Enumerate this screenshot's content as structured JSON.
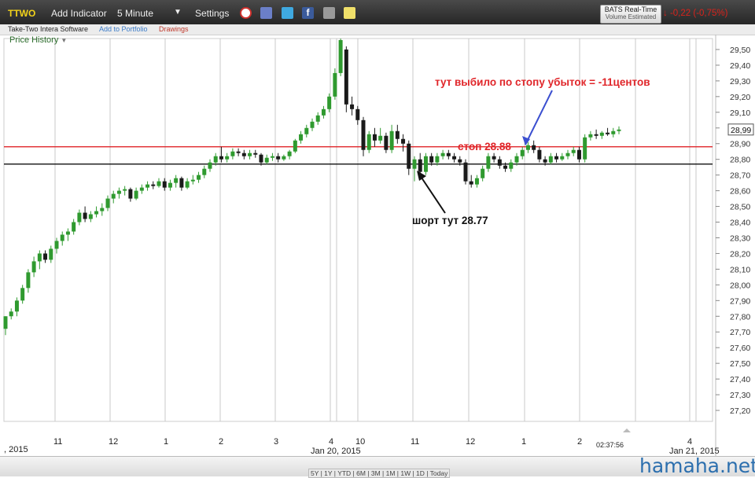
{
  "toolbar": {
    "ticker": "TTWO",
    "add_indicator": "Add Indicator",
    "interval": "5 Minute",
    "settings": "Settings",
    "realtime_title": "BATS Real-Time",
    "realtime_sub": "Volume Estimated",
    "change": "-0,22 (-0,75%)",
    "icons": [
      "alarm-clock-icon",
      "book-icon",
      "twitter-icon",
      "facebook-icon",
      "print-icon",
      "note-icon"
    ]
  },
  "subbar": {
    "company": "Take-Two Intera Software",
    "add_to_portfolio": "Add to Portfolio",
    "drawings": "Drawings"
  },
  "chart_label": "Price History",
  "periods": "5Y | 1Y | YTD | 6M | 3M | 1M | 1W | 1D | Today",
  "watermark": "hamaha.net",
  "chart_data": {
    "type": "candlestick",
    "ylim": [
      27.13,
      29.57
    ],
    "y_ticks": [
      "29,50",
      "29,40",
      "29,30",
      "29,20",
      "29,10",
      "29,00",
      "28,90",
      "28,80",
      "28,70",
      "28,60",
      "28,50",
      "28,40",
      "28,30",
      "28,20",
      "28,10",
      "28,00",
      "27,90",
      "27,80",
      "27,70",
      "27,60",
      "27,50",
      "27,40",
      "27,30",
      "27,20"
    ],
    "last_price": "28,99",
    "x_labels": [
      ", 2015",
      "11",
      "12",
      "1",
      "2",
      "3",
      "4",
      "10",
      "11",
      "12",
      "1",
      "2",
      "4",
      "Jan 20, 2015",
      "Jan 21, 2015",
      "02:37:56"
    ],
    "lines": [
      {
        "name": "stop",
        "value": 28.88,
        "color": "#e0262a"
      },
      {
        "name": "entry",
        "value": 28.77,
        "color": "#111111"
      }
    ],
    "annotations": [
      {
        "text": "тут выбило по стопу убыток = -11центов",
        "color": "#e0262a"
      },
      {
        "text": "стоп 28.88",
        "color": "#e0262a"
      },
      {
        "text": "шорт тут 28.77",
        "color": "#111111"
      }
    ],
    "candles": [
      [
        27.72,
        27.8,
        27.68,
        27.8
      ],
      [
        27.8,
        27.85,
        27.78,
        27.83
      ],
      [
        27.83,
        27.92,
        27.8,
        27.9
      ],
      [
        27.9,
        28.0,
        27.88,
        27.98
      ],
      [
        27.98,
        28.1,
        27.95,
        28.08
      ],
      [
        28.08,
        28.18,
        28.05,
        28.15
      ],
      [
        28.15,
        28.22,
        28.1,
        28.2
      ],
      [
        28.2,
        28.22,
        28.14,
        28.16
      ],
      [
        28.16,
        28.25,
        28.14,
        28.23
      ],
      [
        28.23,
        28.3,
        28.2,
        28.28
      ],
      [
        28.28,
        28.34,
        28.25,
        28.32
      ],
      [
        28.32,
        28.36,
        28.28,
        28.34
      ],
      [
        28.34,
        28.42,
        28.32,
        28.4
      ],
      [
        28.4,
        28.48,
        28.38,
        28.46
      ],
      [
        28.46,
        28.5,
        28.4,
        28.42
      ],
      [
        28.42,
        28.47,
        28.4,
        28.45
      ],
      [
        28.45,
        28.5,
        28.43,
        28.47
      ],
      [
        28.47,
        28.52,
        28.44,
        28.49
      ],
      [
        28.49,
        28.57,
        28.47,
        28.55
      ],
      [
        28.55,
        28.6,
        28.52,
        28.58
      ],
      [
        28.58,
        28.62,
        28.55,
        28.6
      ],
      [
        28.6,
        28.63,
        28.57,
        28.61
      ],
      [
        28.61,
        28.62,
        28.53,
        28.55
      ],
      [
        28.55,
        28.62,
        28.54,
        28.6
      ],
      [
        28.6,
        28.64,
        28.58,
        28.62
      ],
      [
        28.62,
        28.66,
        28.6,
        28.64
      ],
      [
        28.64,
        28.66,
        28.61,
        28.63
      ],
      [
        28.63,
        28.68,
        28.62,
        28.66
      ],
      [
        28.66,
        28.68,
        28.6,
        28.62
      ],
      [
        28.62,
        28.67,
        28.6,
        28.65
      ],
      [
        28.65,
        28.7,
        28.62,
        28.68
      ],
      [
        28.68,
        28.69,
        28.6,
        28.62
      ],
      [
        28.62,
        28.68,
        28.61,
        28.66
      ],
      [
        28.66,
        28.7,
        28.64,
        28.67
      ],
      [
        28.67,
        28.72,
        28.65,
        28.7
      ],
      [
        28.7,
        28.76,
        28.68,
        28.74
      ],
      [
        28.74,
        28.8,
        28.72,
        28.78
      ],
      [
        28.78,
        28.84,
        28.76,
        28.82
      ],
      [
        28.82,
        28.88,
        28.78,
        28.8
      ],
      [
        28.8,
        28.84,
        28.78,
        28.82
      ],
      [
        28.82,
        28.87,
        28.8,
        28.85
      ],
      [
        28.85,
        28.87,
        28.82,
        28.84
      ],
      [
        28.84,
        28.86,
        28.8,
        28.82
      ],
      [
        28.82,
        28.86,
        28.8,
        28.84
      ],
      [
        28.84,
        28.86,
        28.81,
        28.83
      ],
      [
        28.83,
        28.84,
        28.76,
        28.78
      ],
      [
        28.78,
        28.83,
        28.77,
        28.81
      ],
      [
        28.81,
        28.84,
        28.79,
        28.82
      ],
      [
        28.82,
        28.84,
        28.78,
        28.8
      ],
      [
        28.8,
        28.83,
        28.79,
        28.82
      ],
      [
        28.82,
        28.86,
        28.8,
        28.85
      ],
      [
        28.85,
        28.93,
        28.84,
        28.92
      ],
      [
        28.92,
        28.98,
        28.9,
        28.96
      ],
      [
        28.96,
        29.02,
        28.94,
        29.0
      ],
      [
        29.0,
        29.06,
        28.98,
        29.04
      ],
      [
        29.04,
        29.1,
        29.02,
        29.08
      ],
      [
        29.08,
        29.14,
        29.06,
        29.12
      ],
      [
        29.12,
        29.22,
        29.1,
        29.2
      ],
      [
        29.2,
        29.38,
        29.18,
        29.35
      ],
      [
        29.35,
        29.57,
        29.33,
        29.56
      ],
      [
        29.5,
        29.52,
        29.1,
        29.15
      ],
      [
        29.15,
        29.2,
        29.08,
        29.12
      ],
      [
        29.12,
        29.14,
        29.02,
        29.05
      ],
      [
        29.05,
        29.07,
        28.82,
        28.86
      ],
      [
        28.86,
        28.98,
        28.84,
        28.96
      ],
      [
        28.96,
        29.0,
        28.88,
        28.92
      ],
      [
        28.92,
        29.0,
        28.9,
        28.95
      ],
      [
        28.95,
        28.97,
        28.84,
        28.86
      ],
      [
        28.86,
        29.02,
        28.84,
        28.98
      ],
      [
        28.98,
        29.02,
        28.9,
        28.93
      ],
      [
        28.93,
        28.96,
        28.85,
        28.9
      ],
      [
        28.9,
        28.92,
        28.7,
        28.74
      ],
      [
        28.74,
        28.82,
        28.66,
        28.8
      ],
      [
        28.8,
        28.84,
        28.7,
        28.72
      ],
      [
        28.72,
        28.84,
        28.7,
        28.82
      ],
      [
        28.82,
        28.84,
        28.76,
        28.78
      ],
      [
        28.78,
        28.84,
        28.76,
        28.82
      ],
      [
        28.82,
        28.86,
        28.8,
        28.84
      ],
      [
        28.84,
        28.86,
        28.8,
        28.82
      ],
      [
        28.82,
        28.84,
        28.78,
        28.8
      ],
      [
        28.8,
        28.82,
        28.76,
        28.78
      ],
      [
        28.78,
        28.8,
        28.64,
        28.66
      ],
      [
        28.66,
        28.7,
        28.62,
        28.64
      ],
      [
        28.64,
        28.7,
        28.62,
        28.68
      ],
      [
        28.68,
        28.76,
        28.66,
        28.74
      ],
      [
        28.74,
        28.84,
        28.72,
        28.82
      ],
      [
        28.82,
        28.84,
        28.78,
        28.8
      ],
      [
        28.8,
        28.82,
        28.74,
        28.76
      ],
      [
        28.76,
        28.78,
        28.72,
        28.74
      ],
      [
        28.74,
        28.8,
        28.72,
        28.78
      ],
      [
        28.78,
        28.84,
        28.76,
        28.82
      ],
      [
        28.82,
        28.88,
        28.8,
        28.86
      ],
      [
        28.86,
        28.91,
        28.84,
        28.89
      ],
      [
        28.89,
        28.92,
        28.84,
        28.86
      ],
      [
        28.86,
        28.88,
        28.78,
        28.8
      ],
      [
        28.8,
        28.82,
        28.76,
        28.78
      ],
      [
        28.78,
        28.84,
        28.77,
        28.82
      ],
      [
        28.82,
        28.84,
        28.78,
        28.8
      ],
      [
        28.8,
        28.84,
        28.79,
        28.82
      ],
      [
        28.82,
        28.86,
        28.8,
        28.84
      ],
      [
        28.84,
        28.88,
        28.82,
        28.86
      ],
      [
        28.86,
        28.88,
        28.78,
        28.8
      ],
      [
        28.8,
        28.96,
        28.78,
        28.94
      ],
      [
        28.94,
        28.98,
        28.92,
        28.96
      ],
      [
        28.96,
        28.99,
        28.93,
        28.95
      ],
      [
        28.95,
        28.98,
        28.93,
        28.97
      ],
      [
        28.97,
        29.0,
        28.95,
        28.96
      ],
      [
        28.96,
        29.0,
        28.94,
        28.98
      ],
      [
        28.98,
        29.01,
        28.96,
        28.99
      ]
    ]
  }
}
